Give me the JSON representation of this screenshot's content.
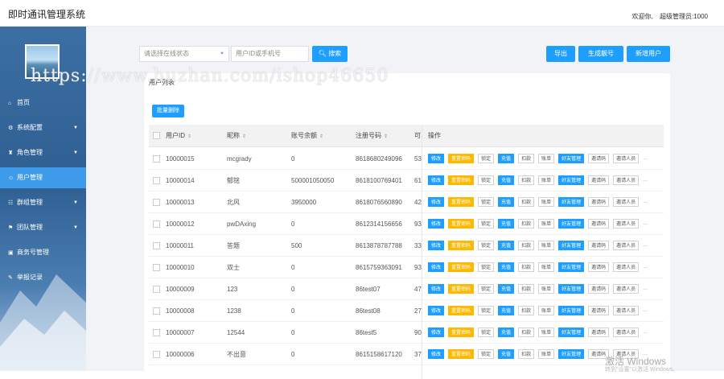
{
  "header": {
    "app_title": "即时通讯管理系统",
    "welcome": "欢迎你,",
    "user": "超级管理员:1000"
  },
  "sidebar": {
    "items": [
      {
        "label": "首页",
        "icon": "home-icon"
      },
      {
        "label": "系统配置",
        "icon": "gear-icon",
        "caret": true
      },
      {
        "label": "角色管理",
        "icon": "role-icon",
        "caret": true
      },
      {
        "label": "用户管理",
        "icon": "user-icon",
        "active": true
      },
      {
        "label": "群组管理",
        "icon": "group-icon",
        "caret": true
      },
      {
        "label": "团队管理",
        "icon": "team-icon",
        "caret": true
      },
      {
        "label": "商务号管理",
        "icon": "business-icon"
      },
      {
        "label": "举报记录",
        "icon": "report-icon"
      }
    ]
  },
  "filters": {
    "status_select": "请选择在线状态",
    "search_placeholder": "用户ID或手机号",
    "search_button": "搜索"
  },
  "actions": {
    "export": "导出",
    "gen_number": "生成靓号",
    "add_user": "新增用户"
  },
  "list": {
    "title": "用户列表",
    "batch_delete": "批量删除",
    "columns": [
      "用户ID",
      "昵称",
      "账号余额",
      "注册号码",
      "可",
      "操作"
    ],
    "rows": [
      {
        "id": "10000015",
        "nick": "mcgrady",
        "balance": "0",
        "phone": "8618680249096",
        "col5": "53"
      },
      {
        "id": "10000014",
        "nick": "郁铭",
        "balance": "500001050050",
        "phone": "8618100769401",
        "col5": "61"
      },
      {
        "id": "10000013",
        "nick": "北风",
        "balance": "3950000",
        "phone": "8618076560890",
        "col5": "42"
      },
      {
        "id": "10000012",
        "nick": "pwDAxing",
        "balance": "0",
        "phone": "8612314156656",
        "col5": "93"
      },
      {
        "id": "10000011",
        "nick": "答题",
        "balance": "500",
        "phone": "8613878787788",
        "col5": "33"
      },
      {
        "id": "10000010",
        "nick": "双士",
        "balance": "0",
        "phone": "8615759363091",
        "col5": "93"
      },
      {
        "id": "10000009",
        "nick": "123",
        "balance": "0",
        "phone": "86test07",
        "col5": "47"
      },
      {
        "id": "10000008",
        "nick": "1238",
        "balance": "0",
        "phone": "86test08",
        "col5": "27"
      },
      {
        "id": "10000007",
        "nick": "12544",
        "balance": "0",
        "phone": "86test5",
        "col5": "90"
      },
      {
        "id": "10000006",
        "nick": "不出意",
        "balance": "0",
        "phone": "8615158617120",
        "col5": "37"
      }
    ],
    "ops": [
      {
        "label": "修改",
        "style": "blue"
      },
      {
        "label": "重置密码",
        "style": "orange"
      },
      {
        "label": "锁定",
        "style": "plain"
      },
      {
        "label": "充值",
        "style": "blue"
      },
      {
        "label": "扣款",
        "style": "plain"
      },
      {
        "label": "账单",
        "style": "plain"
      },
      {
        "label": "好友管理",
        "style": "blue"
      },
      {
        "label": "邀请码",
        "style": "plain"
      },
      {
        "label": "邀请人员",
        "style": "plain"
      }
    ],
    "more": "..."
  },
  "overlays": {
    "watermark": "https://www.huzhan.com/ishop46650",
    "windows": "激活 Windows",
    "windows_sub": "转到\"设置\"以激活 Windows。"
  }
}
